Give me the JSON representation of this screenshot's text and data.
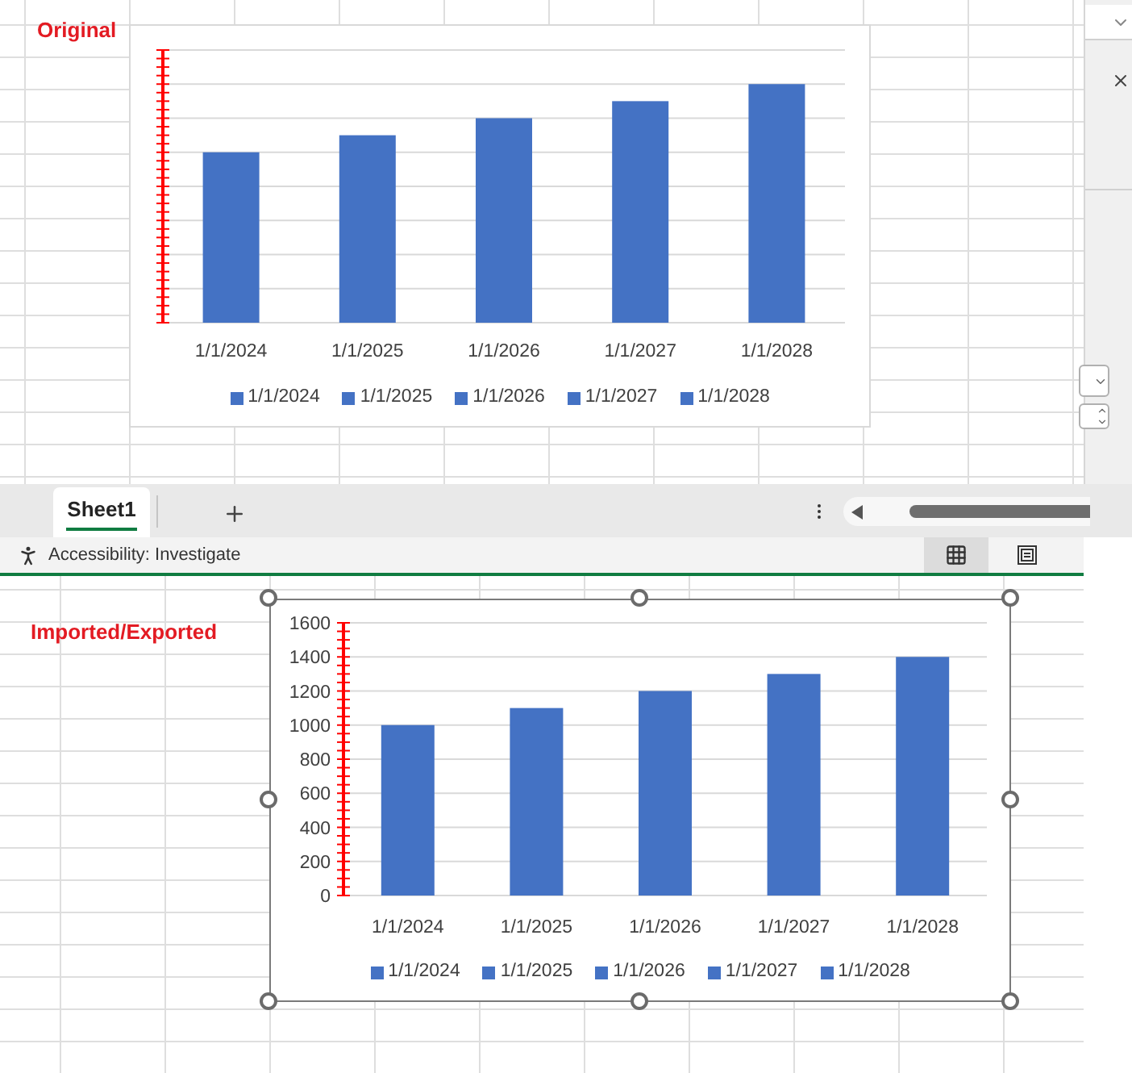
{
  "sheet_top": {
    "caption": "Original",
    "chart": {
      "categories": [
        "1/1/2024",
        "1/1/2025",
        "1/1/2026",
        "1/1/2027",
        "1/1/2028"
      ],
      "legend": [
        "1/1/2024",
        "1/1/2025",
        "1/1/2026",
        "1/1/2027",
        "1/1/2028"
      ]
    }
  },
  "tabs_bar": {
    "tabs": [
      {
        "label": "Sheet1",
        "selected": true
      }
    ]
  },
  "status_bar": {
    "accessibility": "Accessibility: Investigate",
    "views": [
      {
        "kind": "normal",
        "selected": true
      },
      {
        "kind": "page_layout",
        "selected": false
      }
    ]
  },
  "sheet_bottom": {
    "caption": "Imported/Exported",
    "chart": {
      "selected": true,
      "legend": [
        "1/1/2024",
        "1/1/2025",
        "1/1/2026",
        "1/1/2027",
        "1/1/2028"
      ],
      "chart_data": {
        "type": "bar",
        "categories": [
          "1/1/2024",
          "1/1/2025",
          "1/1/2026",
          "1/1/2027",
          "1/1/2028"
        ],
        "values": [
          1000,
          1100,
          1200,
          1300,
          1400
        ],
        "ylim": [
          0,
          1600
        ],
        "grid": true,
        "yticks": [
          0,
          200,
          400,
          600,
          800,
          1000,
          1200,
          1400,
          1600
        ]
      }
    }
  }
}
